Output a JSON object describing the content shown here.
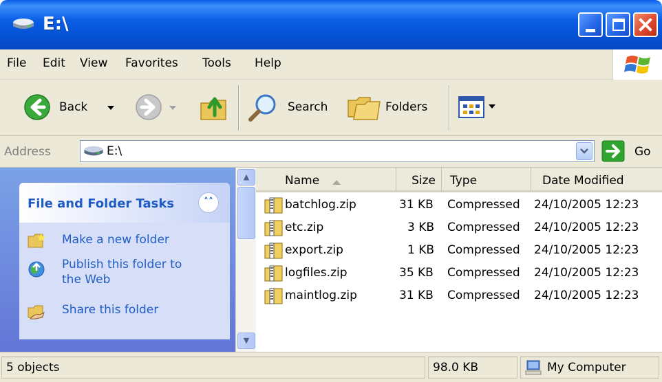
{
  "window": {
    "title": "E:\\"
  },
  "menu": [
    "File",
    "Edit",
    "View",
    "Favorites",
    "Tools",
    "Help"
  ],
  "toolbar": {
    "back": "Back",
    "search": "Search",
    "folders": "Folders"
  },
  "address": {
    "label": "Address",
    "value": "E:\\",
    "go": "Go"
  },
  "tasks": {
    "title": "File and Folder Tasks",
    "items": [
      {
        "label_line1": "Make a new folder",
        "label_line2": ""
      },
      {
        "label_line1": "Publish this folder to",
        "label_line2": "the Web"
      },
      {
        "label_line1": "Share this folder",
        "label_line2": ""
      }
    ]
  },
  "columns": {
    "name": "Name",
    "size": "Size",
    "type": "Type",
    "modified": "Date Modified"
  },
  "files": [
    {
      "name": "batchlog.zip",
      "size": "31 KB",
      "type": "Compressed",
      "modified": "24/10/2005 12:23"
    },
    {
      "name": "etc.zip",
      "size": "3 KB",
      "type": "Compressed",
      "modified": "24/10/2005 12:23"
    },
    {
      "name": "export.zip",
      "size": "1 KB",
      "type": "Compressed",
      "modified": "24/10/2005 12:23"
    },
    {
      "name": "logfiles.zip",
      "size": "35 KB",
      "type": "Compressed",
      "modified": "24/10/2005 12:23"
    },
    {
      "name": "maintlog.zip",
      "size": "31 KB",
      "type": "Compressed",
      "modified": "24/10/2005 12:23"
    }
  ],
  "status": {
    "objects": "5 objects",
    "size": "98.0 KB",
    "location": "My Computer"
  },
  "icons": {
    "title": "drive-icon",
    "back": "back-arrow-icon",
    "forward": "forward-arrow-icon",
    "up": "up-folder-icon",
    "search": "magnifier-icon",
    "folders": "folders-icon",
    "views": "views-icon",
    "go": "go-arrow-icon",
    "zip": "zip-folder-icon",
    "computer": "my-computer-icon"
  },
  "colors": {
    "title_bar": "#0553d6",
    "task_link": "#215dc6",
    "close_button": "#d9452b"
  }
}
